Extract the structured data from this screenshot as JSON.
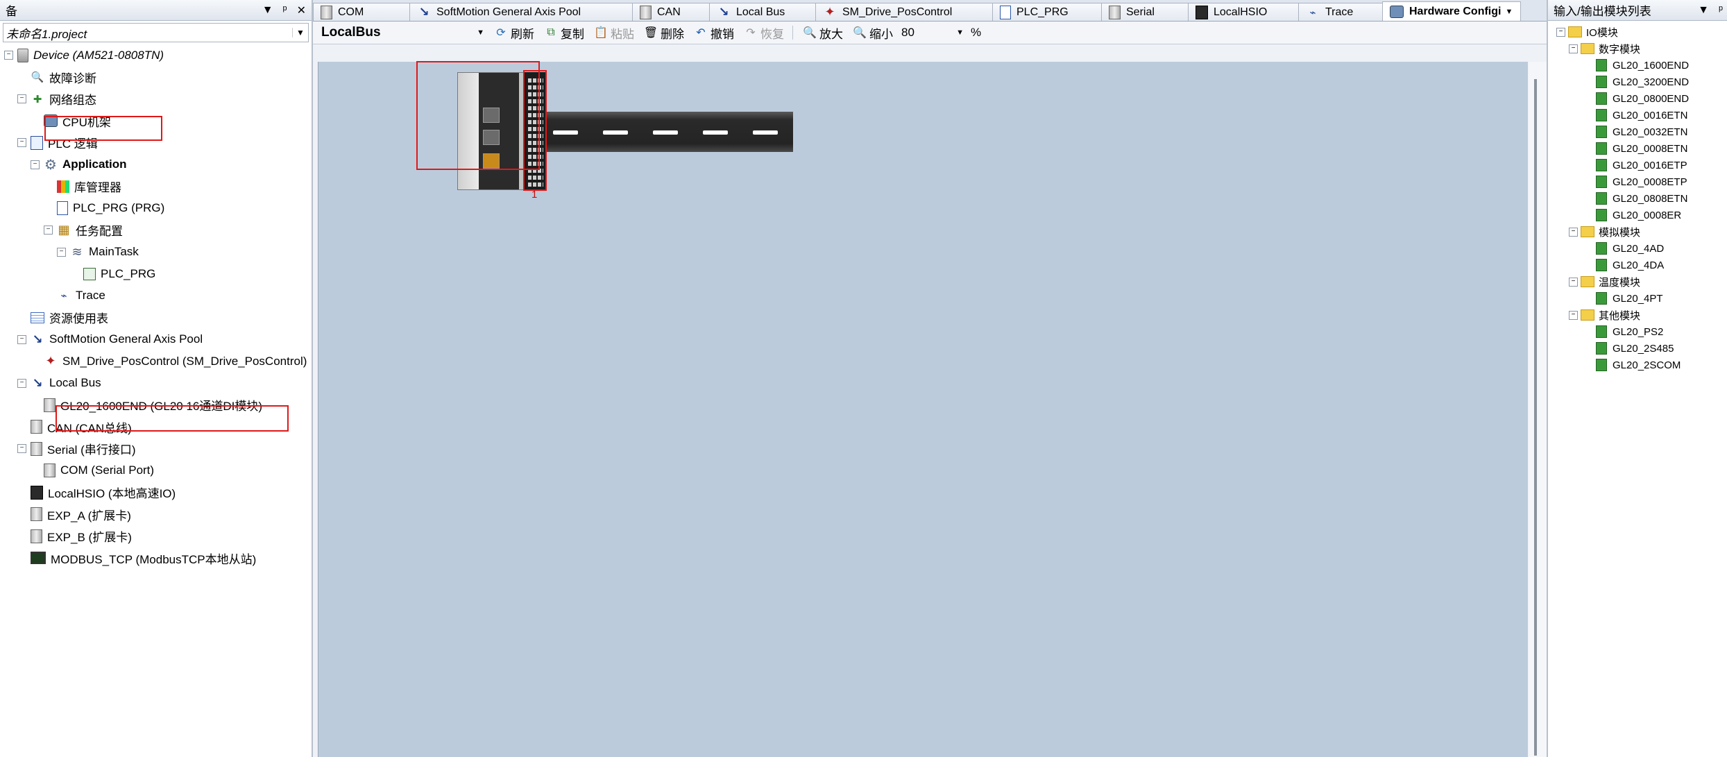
{
  "left_panel": {
    "title": "备",
    "controls": {
      "dropdown": "▼",
      "pin": "ᵖ",
      "close": "✕"
    },
    "project_combo": "未命名1.project",
    "tree": [
      {
        "label": "Device (AM521-0808TN)",
        "level": 0,
        "expander": "⊟",
        "icon": "device-icon",
        "italic": true
      },
      {
        "label": "故障诊断",
        "level": 1,
        "expander": "",
        "icon": "search-icon"
      },
      {
        "label": "网络组态",
        "level": 1,
        "expander": "⊟",
        "icon": "network-icon"
      },
      {
        "label": "CPU机架",
        "level": 2,
        "expander": "",
        "icon": "cpu-rack-icon",
        "highlight": true
      },
      {
        "label": "PLC 逻辑",
        "level": 1,
        "expander": "⊟",
        "icon": "plc-logic-icon"
      },
      {
        "label": "Application",
        "level": 2,
        "expander": "⊟",
        "icon": "gear-icon",
        "bold": true
      },
      {
        "label": "库管理器",
        "level": 3,
        "expander": "",
        "icon": "library-icon"
      },
      {
        "label": "PLC_PRG (PRG)",
        "level": 3,
        "expander": "",
        "icon": "document-icon"
      },
      {
        "label": "任务配置",
        "level": 3,
        "expander": "⊟",
        "icon": "task-config-icon"
      },
      {
        "label": "MainTask",
        "level": 4,
        "expander": "⊟",
        "icon": "task-stack-icon"
      },
      {
        "label": "PLC_PRG",
        "level": 5,
        "expander": "",
        "icon": "program-icon"
      },
      {
        "label": "Trace",
        "level": 3,
        "expander": "",
        "icon": "trace-icon"
      },
      {
        "label": "资源使用表",
        "level": 1,
        "expander": "",
        "icon": "table-icon"
      },
      {
        "label": "SoftMotion General Axis Pool",
        "level": 1,
        "expander": "⊟",
        "icon": "axis-icon"
      },
      {
        "label": "SM_Drive_PosControl (SM_Drive_PosControl)",
        "level": 2,
        "expander": "",
        "icon": "drive-icon"
      },
      {
        "label": "Local Bus",
        "level": 1,
        "expander": "⊟",
        "icon": "axis-icon"
      },
      {
        "label": "GL20_1600END (GL20 16通道DI模块)",
        "level": 2,
        "expander": "",
        "icon": "module-icon",
        "highlight": true
      },
      {
        "label": "CAN (CAN总线)",
        "level": 1,
        "expander": "",
        "icon": "module-icon"
      },
      {
        "label": "Serial (串行接口)",
        "level": 1,
        "expander": "⊟",
        "icon": "module-icon"
      },
      {
        "label": "COM (Serial Port)",
        "level": 2,
        "expander": "",
        "icon": "module-icon"
      },
      {
        "label": "LocalHSIO (本地高速IO)",
        "level": 1,
        "expander": "",
        "icon": "hsio-icon"
      },
      {
        "label": "EXP_A (扩展卡)",
        "level": 1,
        "expander": "",
        "icon": "module-icon"
      },
      {
        "label": "EXP_B (扩展卡)",
        "level": 1,
        "expander": "",
        "icon": "module-icon"
      },
      {
        "label": "MODBUS_TCP (ModbusTCP本地从站)",
        "level": 1,
        "expander": "",
        "icon": "modbus-icon"
      }
    ]
  },
  "tabs": [
    {
      "label": "COM",
      "icon": "module-icon"
    },
    {
      "label": "SoftMotion General Axis Pool",
      "icon": "axis-icon"
    },
    {
      "label": "CAN",
      "icon": "module-icon"
    },
    {
      "label": "Local Bus",
      "icon": "axis-icon"
    },
    {
      "label": "SM_Drive_PosControl",
      "icon": "drive-icon"
    },
    {
      "label": "PLC_PRG",
      "icon": "document-icon"
    },
    {
      "label": "Serial",
      "icon": "module-icon"
    },
    {
      "label": "LocalHSIO",
      "icon": "hsio-icon"
    },
    {
      "label": "Trace",
      "icon": "trace-icon"
    },
    {
      "label": "Hardware Configi",
      "icon": "cpu-rack-icon",
      "active": true
    }
  ],
  "toolbar": {
    "bus_combo": "LocalBus",
    "refresh": "刷新",
    "copy": "复制",
    "paste": "粘贴",
    "delete": "删除",
    "undo": "撤销",
    "redo": "恢复",
    "zoom_in": "放大",
    "zoom_out": "缩小",
    "zoom_value": "80",
    "zoom_unit": "%"
  },
  "canvas": {
    "slot_number": "1"
  },
  "right_panel": {
    "title": "输入/输出模块列表",
    "controls": {
      "dropdown": "▼",
      "pin": "ᵖ"
    },
    "root": "IO模块",
    "groups": [
      {
        "name": "数字模块",
        "items": [
          "GL20_1600END",
          "GL20_3200END",
          "GL20_0800END",
          "GL20_0016ETN",
          "GL20_0032ETN",
          "GL20_0008ETN",
          "GL20_0016ETP",
          "GL20_0008ETP",
          "GL20_0808ETN",
          "GL20_0008ER"
        ]
      },
      {
        "name": "模拟模块",
        "items": [
          "GL20_4AD",
          "GL20_4DA"
        ]
      },
      {
        "name": "温度模块",
        "items": [
          "GL20_4PT"
        ]
      },
      {
        "name": "其他模块",
        "items": [
          "GL20_PS2",
          "GL20_2S485",
          "GL20_2SCOM"
        ]
      }
    ]
  }
}
